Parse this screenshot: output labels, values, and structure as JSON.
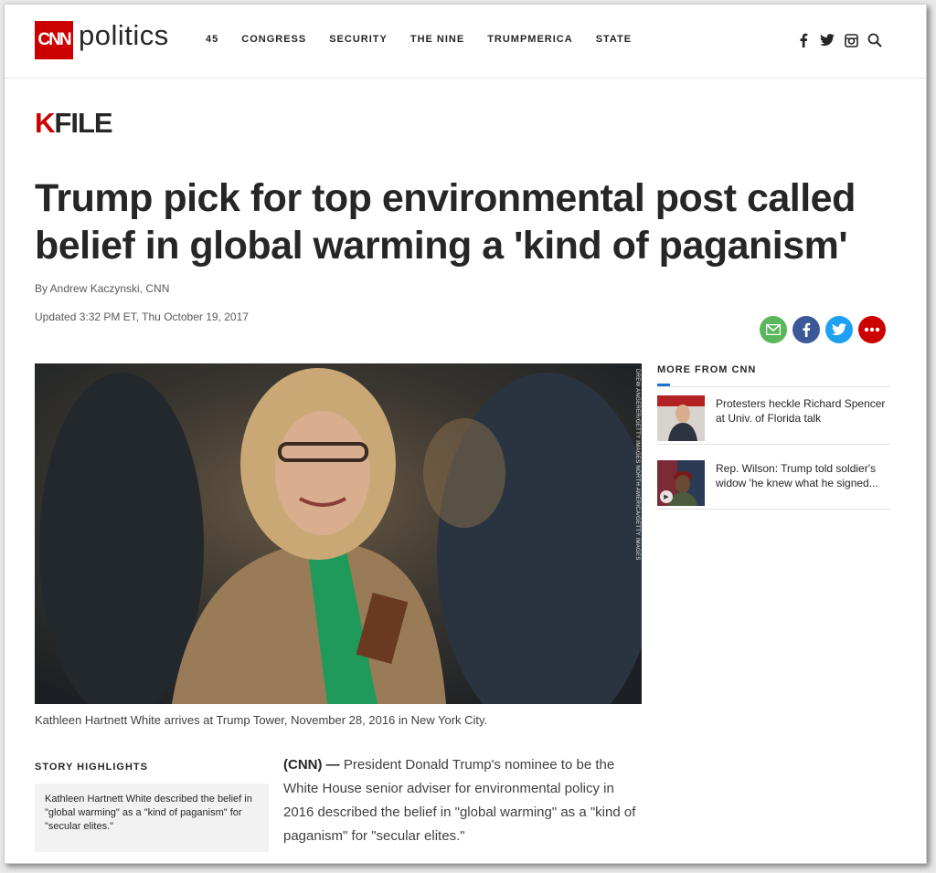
{
  "header": {
    "logo_text": "CNN",
    "section": "politics",
    "nav": [
      "45",
      "CONGRESS",
      "SECURITY",
      "THE NINE",
      "TRUMPMERICA",
      "STATE"
    ],
    "icons": [
      "facebook-icon",
      "twitter-icon",
      "instagram-icon",
      "search-icon"
    ]
  },
  "kfile": {
    "k": "K",
    "rest": "FILE"
  },
  "article": {
    "headline": "Trump pick for top environmental post called belief in global warming a 'kind of paganism'",
    "byline": "By Andrew Kaczynski, CNN",
    "updated": "Updated 3:32 PM ET, Thu October 19, 2017",
    "photo_credit": "DREW ANGERER/GETTY IMAGES NORTH AMERICA/GETTY IMAGES",
    "caption": "Kathleen Hartnett White arrives at Trump Tower, November 28, 2016 in New York City.",
    "lead": "(CNN) —",
    "body": " President Donald Trump's nominee to be the White House senior adviser for environmental policy in 2016 described the belief in \"global warming\" as a \"kind of paganism\" for \"secular elites.\""
  },
  "share": {
    "colors": {
      "email": "#5bb75b",
      "facebook": "#3b5998",
      "twitter": "#1da1f2",
      "more": "#cc0000"
    }
  },
  "more_from": {
    "title": "MORE FROM CNN",
    "items": [
      {
        "text": "Protesters heckle Richard Spencer at Univ. of Florida talk"
      },
      {
        "text": "Rep. Wilson: Trump told soldier's widow 'he knew what he signed..."
      }
    ]
  },
  "highlights": {
    "title": "STORY HIGHLIGHTS",
    "items": [
      "Kathleen Hartnett White described the belief in \"global warming\" as a \"kind of paganism\" for \"secular elites.\""
    ]
  }
}
